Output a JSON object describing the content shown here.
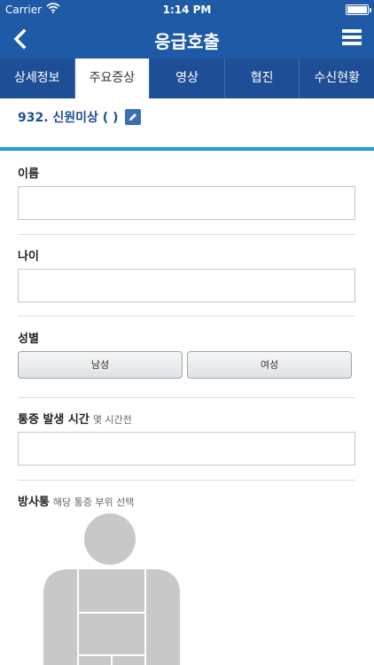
{
  "status_bar": {
    "carrier": "Carrier",
    "time": "1:14 PM"
  },
  "nav": {
    "title": "응급호출"
  },
  "tabs": [
    {
      "label": "상세정보",
      "active": false
    },
    {
      "label": "주요증상",
      "active": true
    },
    {
      "label": "영상",
      "active": false
    },
    {
      "label": "협진",
      "active": false
    },
    {
      "label": "수신현황",
      "active": false
    }
  ],
  "case": {
    "label": "932. 신원미상 ( )"
  },
  "form": {
    "name_label": "이름",
    "name_value": "",
    "age_label": "나이",
    "age_value": "",
    "gender_label": "성별",
    "gender_male": "남성",
    "gender_female": "여성",
    "pain_time_label": "통증 발생 시간",
    "pain_time_sub": "몇 시간전",
    "pain_time_value": "",
    "radiating_label": "방사통",
    "radiating_sub": "해당 통증 부위 선택"
  },
  "colors": {
    "nav": "#1e5aa6",
    "tabs": "#1e4f96",
    "accent_strip": "#1e9be0",
    "body_fill": "#c8c8c8"
  }
}
